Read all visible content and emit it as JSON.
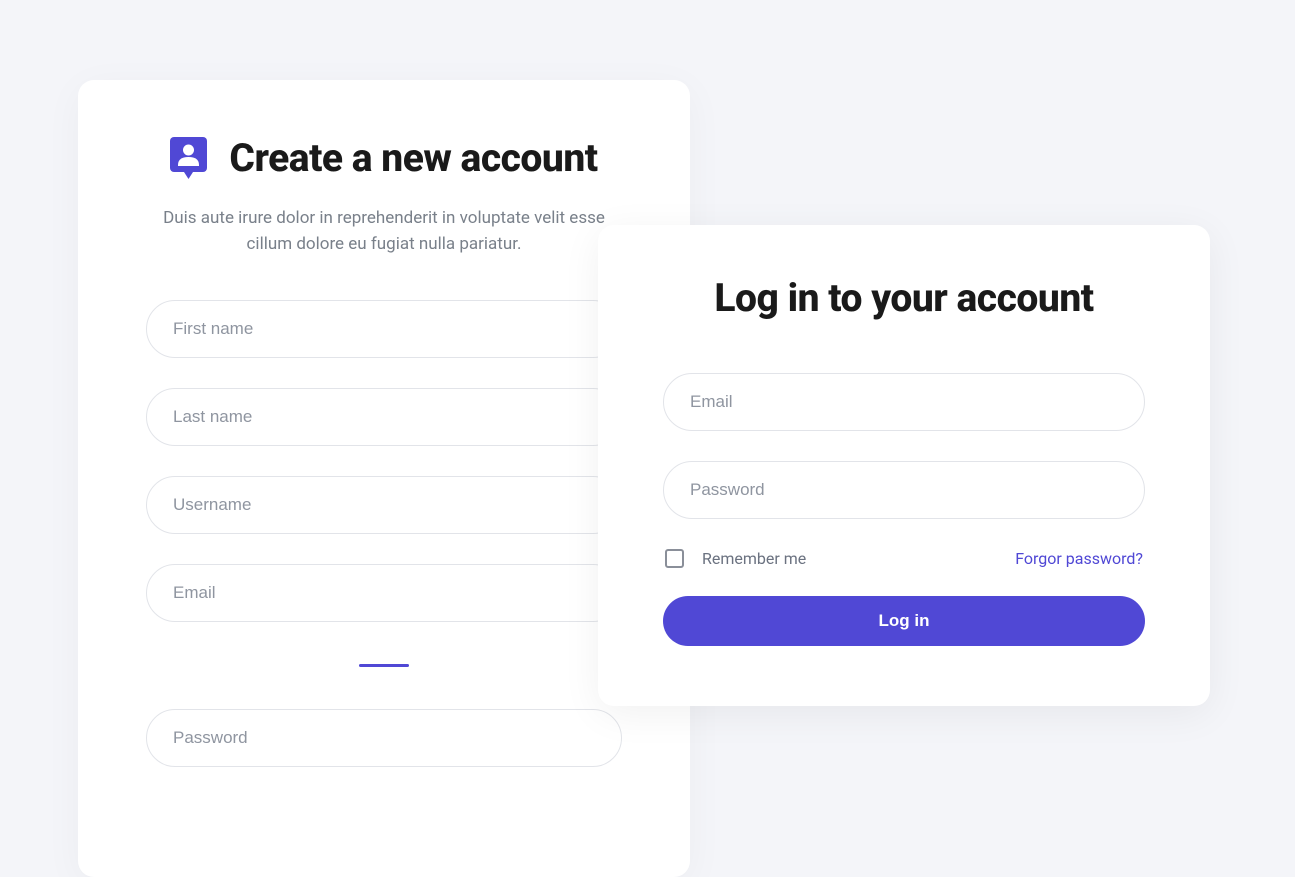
{
  "signup": {
    "title": "Create a new account",
    "description": "Duis aute irure dolor in reprehenderit in voluptate velit esse cillum dolore eu fugiat nulla pariatur.",
    "fields": {
      "first_name_placeholder": "First name",
      "last_name_placeholder": "Last name",
      "username_placeholder": "Username",
      "email_placeholder": "Email",
      "password_placeholder": "Password"
    }
  },
  "login": {
    "title": "Log in to your account",
    "fields": {
      "email_placeholder": "Email",
      "password_placeholder": "Password"
    },
    "remember_label": "Remember me",
    "forgot_label": "Forgor password?",
    "button_label": "Log in"
  },
  "colors": {
    "accent": "#5048d5"
  }
}
